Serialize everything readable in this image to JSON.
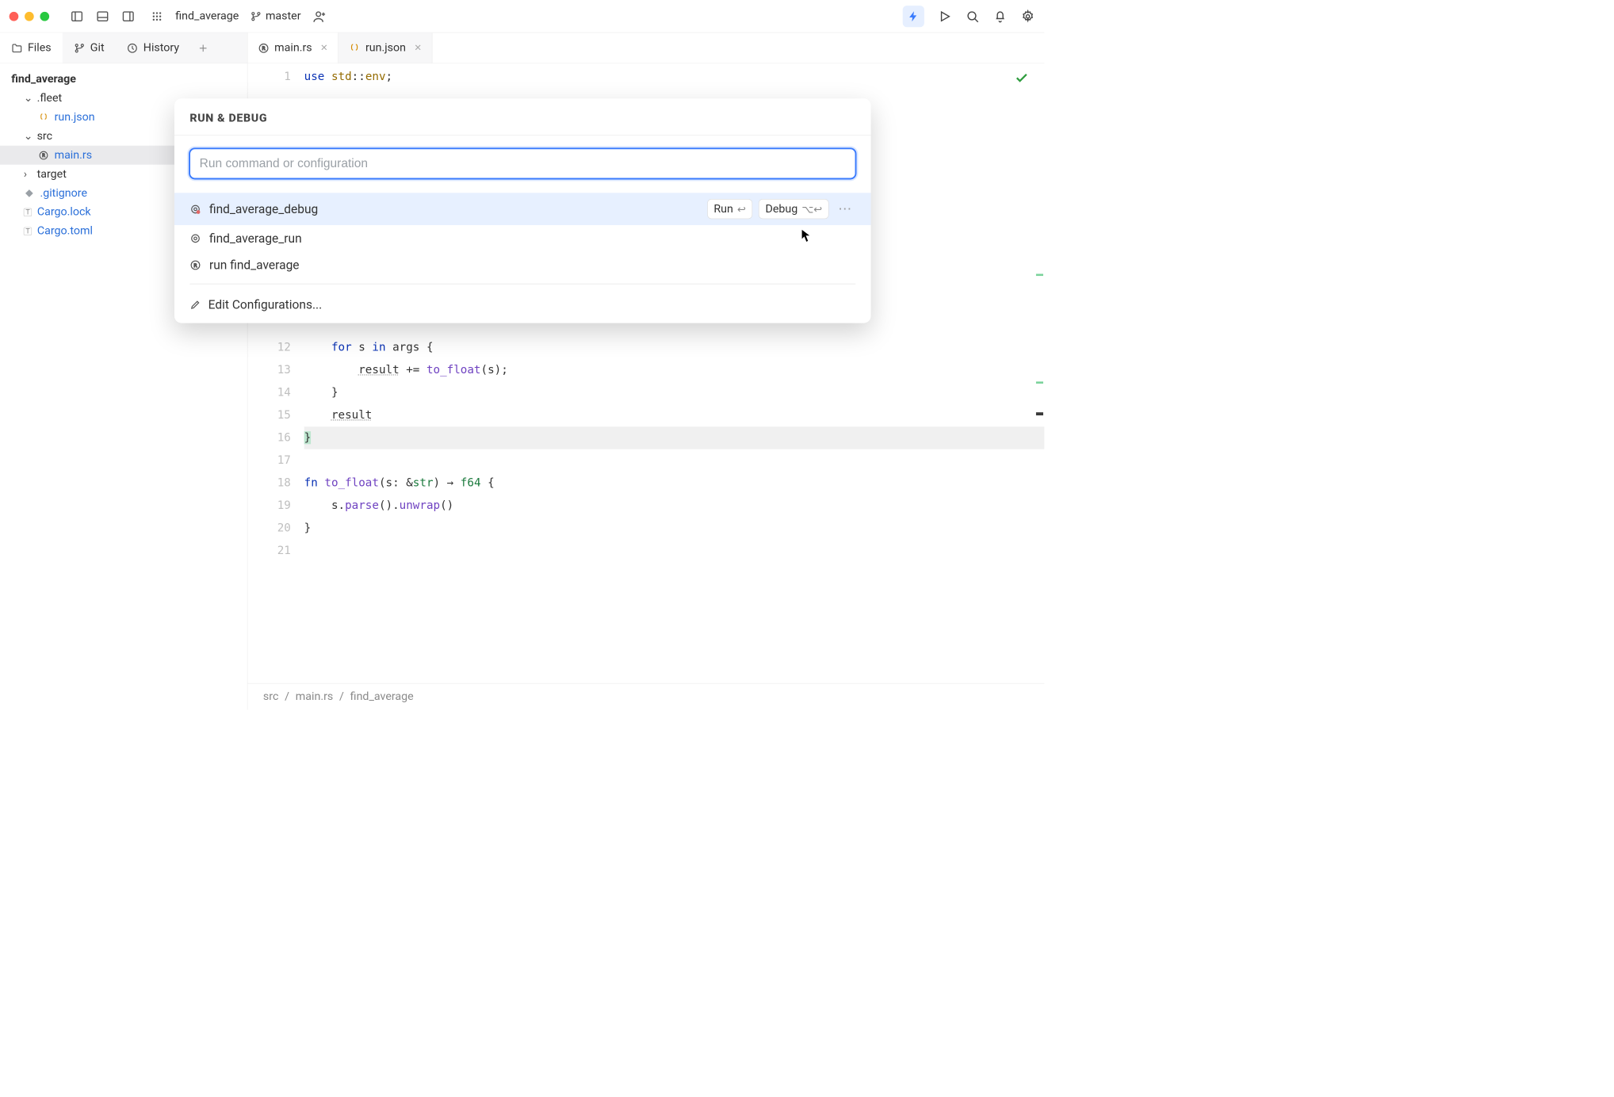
{
  "titlebar": {
    "project": "find_average",
    "branch": "master"
  },
  "left_tabs": {
    "files": "Files",
    "git": "Git",
    "history": "History"
  },
  "editor_tabs": {
    "main": "main.rs",
    "run": "run.json"
  },
  "tree": {
    "root": "find_average",
    "fleet_dir": ".fleet",
    "run_json": "run.json",
    "src_dir": "src",
    "main_rs": "main.rs",
    "target_dir": "target",
    "gitignore": ".gitignore",
    "cargo_lock": "Cargo.lock",
    "cargo_toml": "Cargo.toml"
  },
  "code": {
    "lines": [
      "use std::env;",
      "",
      "",
      "",
      "",
      "",
      "",
      "",
      "",
      "",
      "",
      "    for s in args {",
      "        result += to_float(s);",
      "    }",
      "    result",
      "}",
      "",
      "fn to_float(s: &str) → f64 {",
      "    s.parse().unwrap()",
      "}",
      ""
    ],
    "line_numbers": [
      "1",
      "12",
      "13",
      "14",
      "15",
      "16",
      "17",
      "18",
      "19",
      "20",
      "21"
    ]
  },
  "popup": {
    "title": "RUN & DEBUG",
    "placeholder": "Run command or configuration",
    "configs": [
      "find_average_debug",
      "find_average_run",
      "run find_average"
    ],
    "run_label": "Run",
    "debug_label": "Debug",
    "edit_label": "Edit Configurations..."
  },
  "breadcrumb": {
    "seg1": "src",
    "seg2": "main.rs",
    "seg3": "find_average"
  },
  "colors": {
    "accent": "#3a7bfd",
    "selected_row": "#e7f0ff",
    "green_mark": "#7bd39b",
    "dark_mark": "#3a3a3a"
  }
}
